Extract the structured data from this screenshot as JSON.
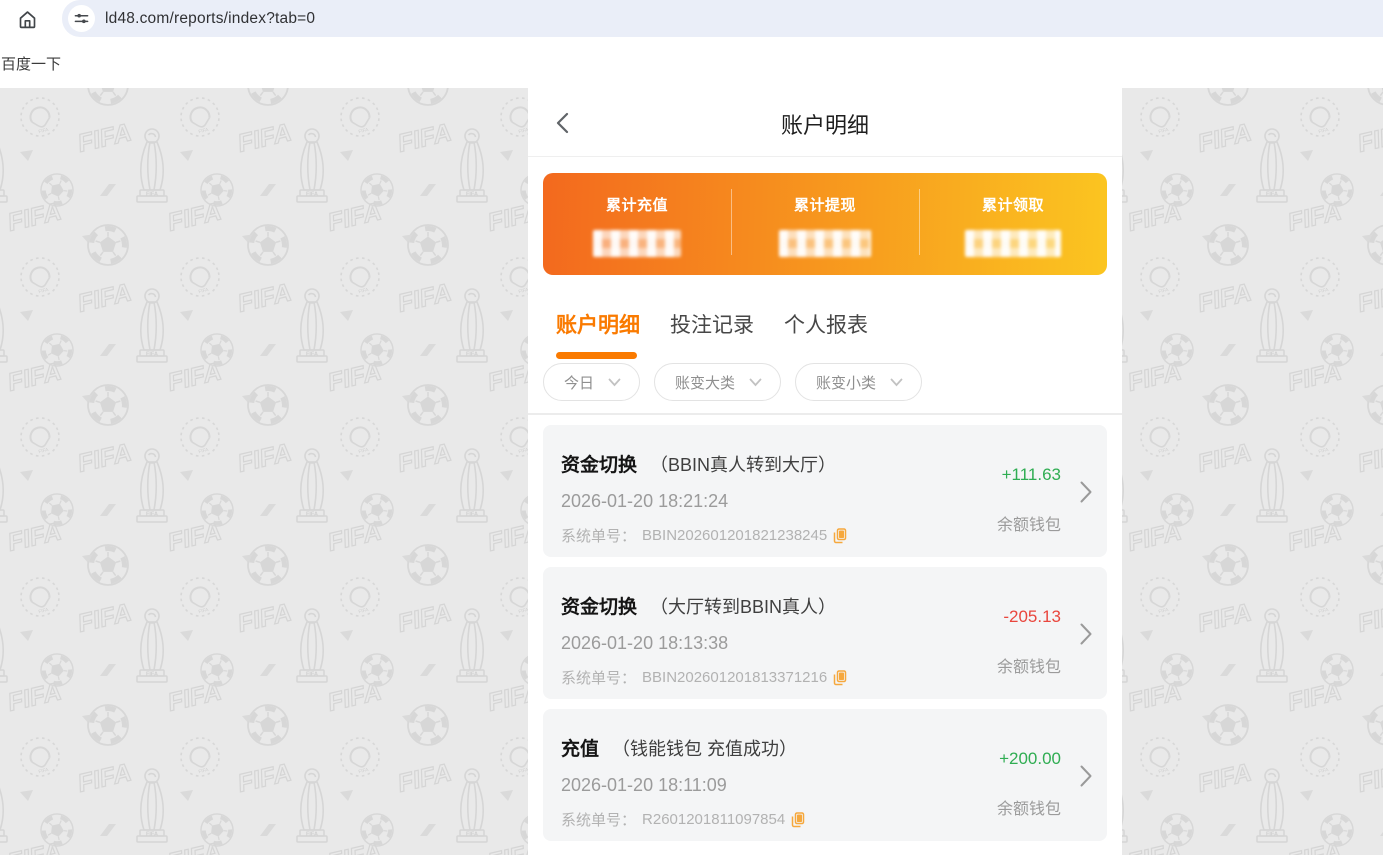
{
  "browser": {
    "url": "ld48.com/reports/index?tab=0",
    "bookmark_label": "百度一下"
  },
  "header": {
    "title": "账户明细"
  },
  "summary": {
    "items": [
      {
        "label": "累计充值",
        "value": "",
        "masked": true
      },
      {
        "label": "累计提现",
        "value": "",
        "masked": true
      },
      {
        "label": "累计领取",
        "value": "",
        "masked": true
      }
    ]
  },
  "tabs": [
    {
      "label": "账户明细",
      "active": true
    },
    {
      "label": "投注记录",
      "active": false
    },
    {
      "label": "个人报表",
      "active": false
    }
  ],
  "filters": [
    {
      "label": "今日"
    },
    {
      "label": "账变大类"
    },
    {
      "label": "账变小类"
    }
  ],
  "transactions": [
    {
      "type": "资金切换",
      "detail": "（BBIN真人转到大厅）",
      "datetime": "2026-01-20 18:21:24",
      "order_label": "系统单号：",
      "order_no": "BBIN202601201821238245",
      "amount": "+111.63",
      "direction": "positive",
      "wallet": "余额钱包"
    },
    {
      "type": "资金切换",
      "detail": "（大厅转到BBIN真人）",
      "datetime": "2026-01-20 18:13:38",
      "order_label": "系统单号：",
      "order_no": "BBIN202601201813371216",
      "amount": "-205.13",
      "direction": "negative",
      "wallet": "余额钱包"
    },
    {
      "type": "充值",
      "detail": "（钱能钱包 充值成功）",
      "datetime": "2026-01-20 18:11:09",
      "order_label": "系统单号：",
      "order_no": "R2601201811097854",
      "amount": "+200.00",
      "direction": "positive",
      "wallet": "余额钱包"
    }
  ],
  "colors": {
    "accent_orange": "#fa7a00",
    "gradient_start": "#f3691e",
    "gradient_end": "#fbc520",
    "positive_green": "#2fad52",
    "negative_red": "#e9463d",
    "copy_icon_orange": "#f6a83d",
    "omnibox_bg": "#eaeef8"
  }
}
